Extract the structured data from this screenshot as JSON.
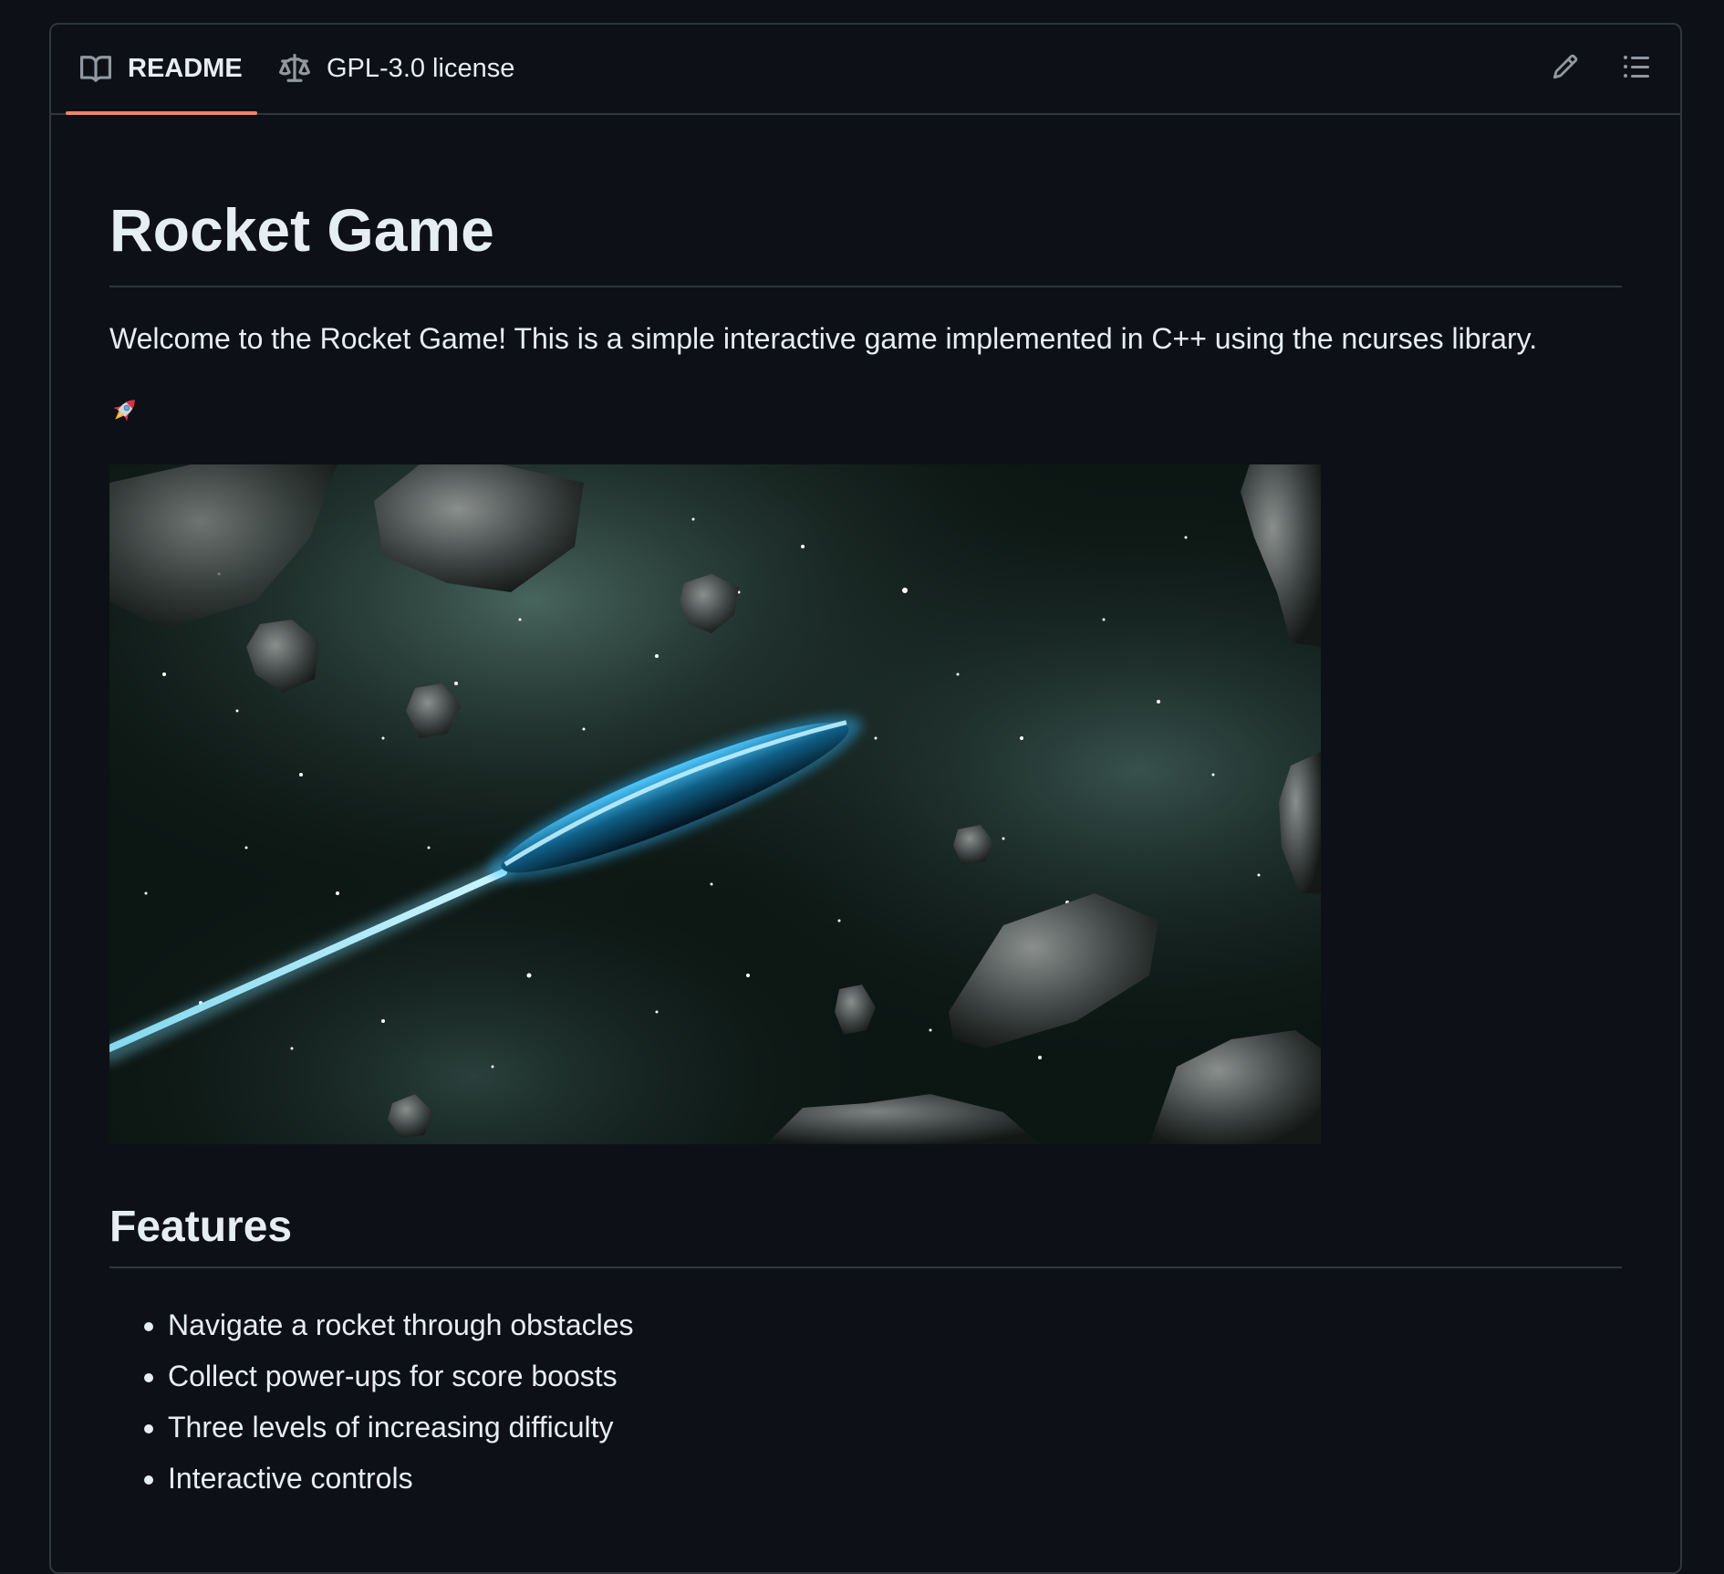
{
  "tabs": {
    "readme_label": "README",
    "license_label": "GPL-3.0 license"
  },
  "readme": {
    "title": "Rocket Game",
    "intro": "Welcome to the Rocket Game! This is a simple interactive game implemented in C++ using the ncurses library.",
    "emoji": "🚀",
    "features_heading": "Features",
    "features": [
      "Navigate a rocket through obstacles",
      "Collect power-ups for score boosts",
      "Three levels of increasing difficulty",
      "Interactive controls"
    ]
  },
  "icons": {
    "readme_tab": "book-icon",
    "license_tab": "scale-icon",
    "edit": "pencil-icon",
    "outline": "list-icon"
  },
  "colors": {
    "background": "#0d1117",
    "border": "#30363d",
    "text": "#e6edf3",
    "icon": "#9198a1",
    "tab_accent": "#f78166"
  }
}
